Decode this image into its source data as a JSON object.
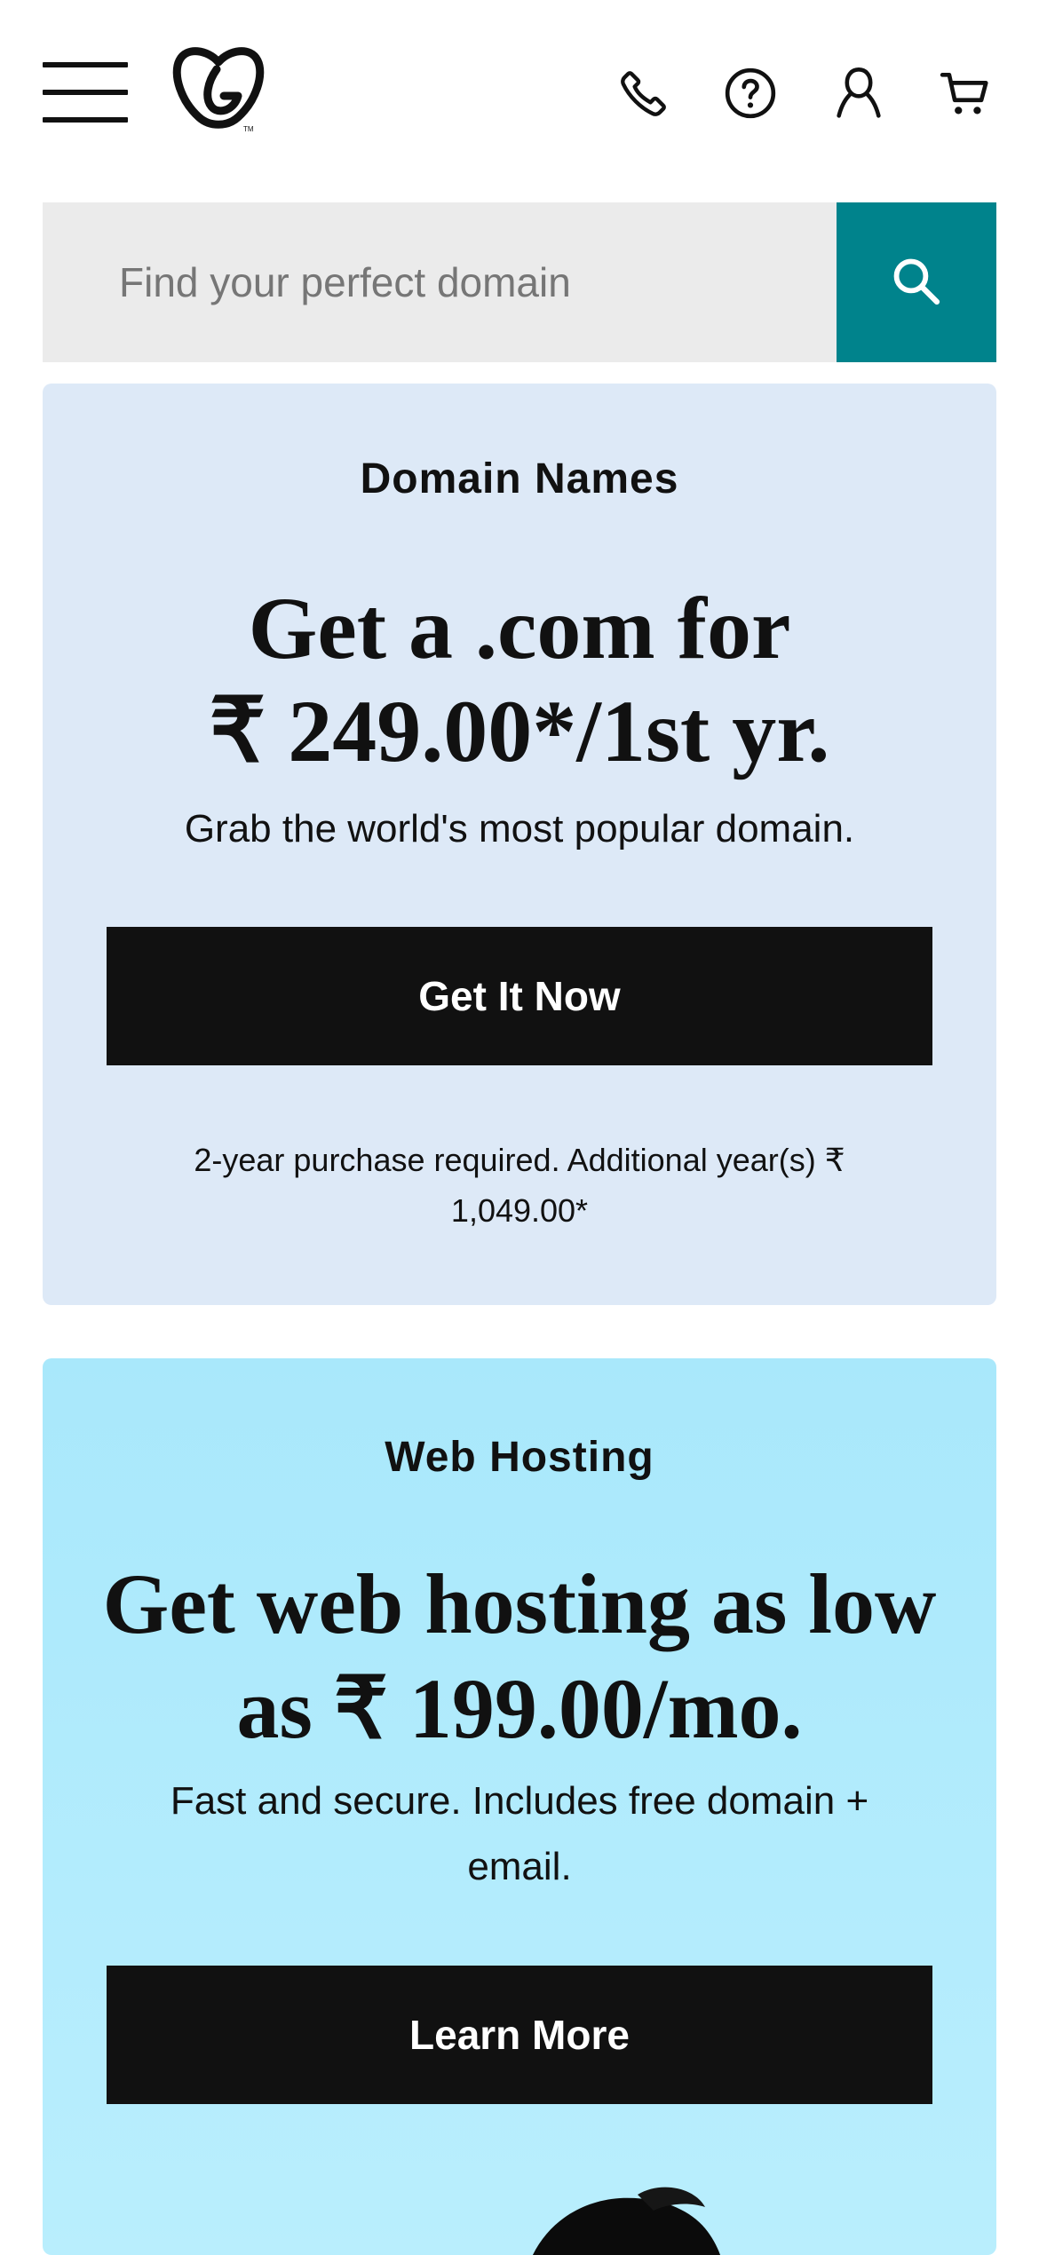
{
  "header": {
    "menu_icon": "hamburger-menu-icon",
    "logo_icon": "godaddy-logo-icon",
    "icons": [
      "phone-icon",
      "help-icon",
      "account-icon",
      "cart-icon"
    ]
  },
  "search": {
    "placeholder": "Find your perfect domain",
    "value": "",
    "button_icon": "search-icon",
    "button_color": "#00838c"
  },
  "domain_card": {
    "eyebrow": "Domain Names",
    "headline_line1": "Get a .com for",
    "headline_line2": "₹ 249.00*/1st yr.",
    "subtext": "Grab the world's most popular domain.",
    "cta_label": "Get It Now",
    "disclaimer_line1": "2-year purchase required. Additional year(s) ₹",
    "disclaimer_line2": "1,049.00*",
    "background": "#dde9f7"
  },
  "hosting_card": {
    "eyebrow": "Web Hosting",
    "headline_line1": "Get web hosting as low",
    "headline_line2": "as ₹ 199.00/mo.",
    "subtext_line1": "Fast and secure. Includes free domain +",
    "subtext_line2": "email.",
    "cta_label": "Learn More",
    "background": "#b3ecfd",
    "image_icon": "person-photo"
  }
}
